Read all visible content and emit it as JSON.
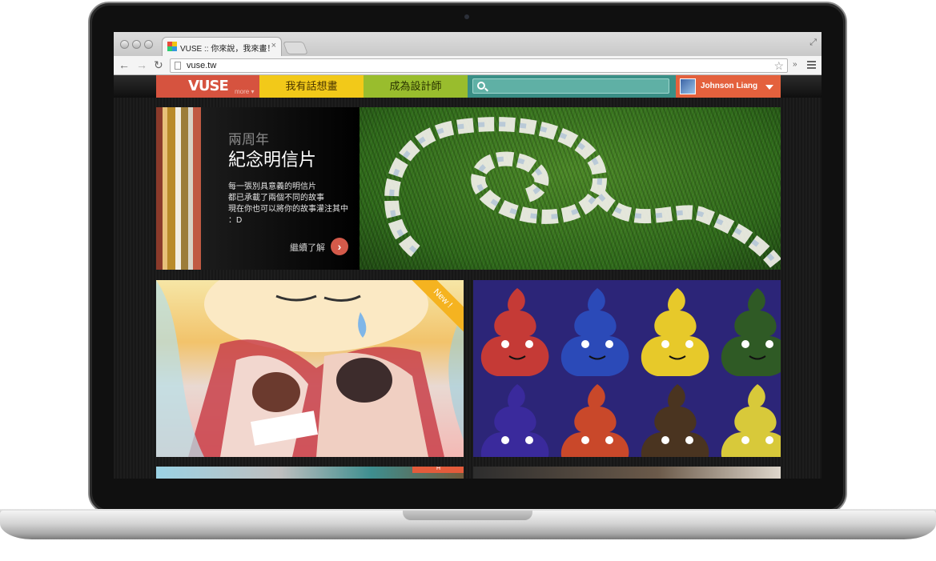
{
  "browser": {
    "tab_title": "VUSE :: 你來說，我來畫！",
    "tab_close": "×",
    "url": "vuse.tw",
    "overflow": "»",
    "restore": "⤢"
  },
  "site": {
    "logo": "VUSE",
    "logo_more": "more ▾",
    "nav": [
      "我有話想畫",
      "成為設計師"
    ],
    "search_placeholder": "",
    "user_name": "Johnson Liang"
  },
  "hero": {
    "subtitle": "兩周年",
    "title": "紀念明信片",
    "description": [
      "每一張別具意義的明信片",
      "都已承載了兩個不同的故事",
      "現在你也可以將你的故事灌注其中",
      "：D"
    ],
    "more": "繼續了解"
  },
  "tiles": {
    "new_badge": "New !",
    "bottom_badge": "H"
  },
  "colors": {
    "logo": "#d6533f",
    "nav_yellow": "#f2c919",
    "nav_green": "#99bd2d",
    "search": "#3a8f86",
    "user": "#e4613d"
  }
}
